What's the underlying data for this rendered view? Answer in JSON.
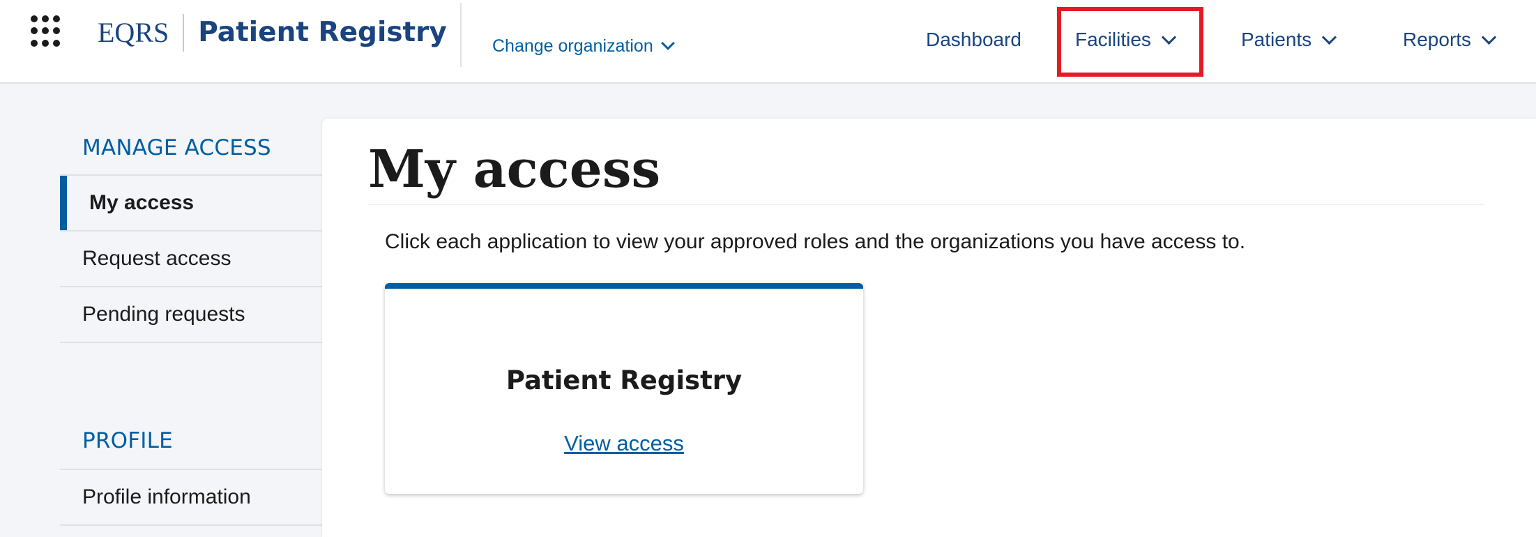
{
  "header": {
    "brand_short": "EQRS",
    "brand_product": "Patient Registry",
    "change_org_label": "Change organization",
    "nav": [
      {
        "label": "Dashboard"
      },
      {
        "label": "Facilities"
      },
      {
        "label": "Patients"
      },
      {
        "label": "Reports"
      }
    ]
  },
  "sidebar": {
    "manage_heading": "MANAGE ACCESS",
    "manage_items": [
      {
        "label": "My access",
        "active": true
      },
      {
        "label": "Request access"
      },
      {
        "label": "Pending requests"
      }
    ],
    "profile_heading": "PROFILE",
    "profile_items": [
      {
        "label": "Profile information"
      }
    ]
  },
  "main": {
    "title": "My access",
    "intro": "Click each application to view your approved roles and the organizations you have access to.",
    "card": {
      "title": "Patient Registry",
      "link_label": "View access"
    }
  },
  "colors": {
    "brand_navy": "#1a4480",
    "link_blue": "#005ea2",
    "highlight_red": "#e31c23"
  },
  "icons": {
    "app_grid": "grid-icon",
    "dropdown": "chevron-down-icon"
  }
}
